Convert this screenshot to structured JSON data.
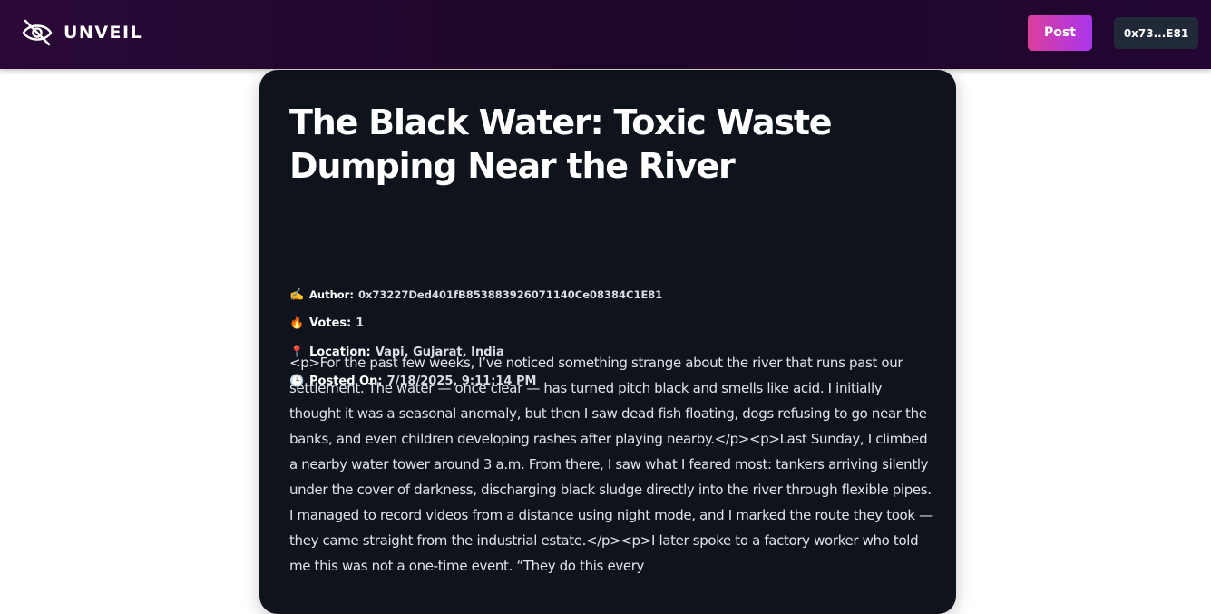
{
  "header": {
    "brand_name": "UNVEIL",
    "post_label": "Post",
    "wallet_label": "0x73...E81"
  },
  "post": {
    "title": "The Black Water: Toxic Waste Dumping Near the River",
    "meta": {
      "author_icon": "✍️",
      "author_label": "Author:",
      "author_value": "0x73227Ded401fB853883926071140Ce08384C1E81",
      "votes_icon": "🔥",
      "votes_label": "Votes:",
      "votes_value": "1",
      "location_icon": "📍",
      "location_label": "Location:",
      "location_value": "Vapi, Gujarat, India",
      "posted_icon": "🕒",
      "posted_label": "Posted On:",
      "posted_value": "7/18/2025, 9:11:14 PM"
    },
    "body": "<p>For the past few weeks, I’ve noticed something strange about the river that runs past our settlement. The water — once clear — has turned pitch black and smells like acid. I initially thought it was a seasonal anomaly, but then I saw dead fish floating, dogs refusing to go near the banks, and even children developing rashes after playing nearby.</p><p>Last Sunday, I climbed a nearby water tower around 3 a.m. From there, I saw what I feared most: tankers arriving silently under the cover of darkness, discharging black sludge directly into the river through flexible pipes. I managed to record videos from a distance using night mode, and I marked the route they took — they came straight from the industrial estate.</p><p>I later spoke to a factory worker who told me this was not a one-time event. “They do this every"
  }
}
